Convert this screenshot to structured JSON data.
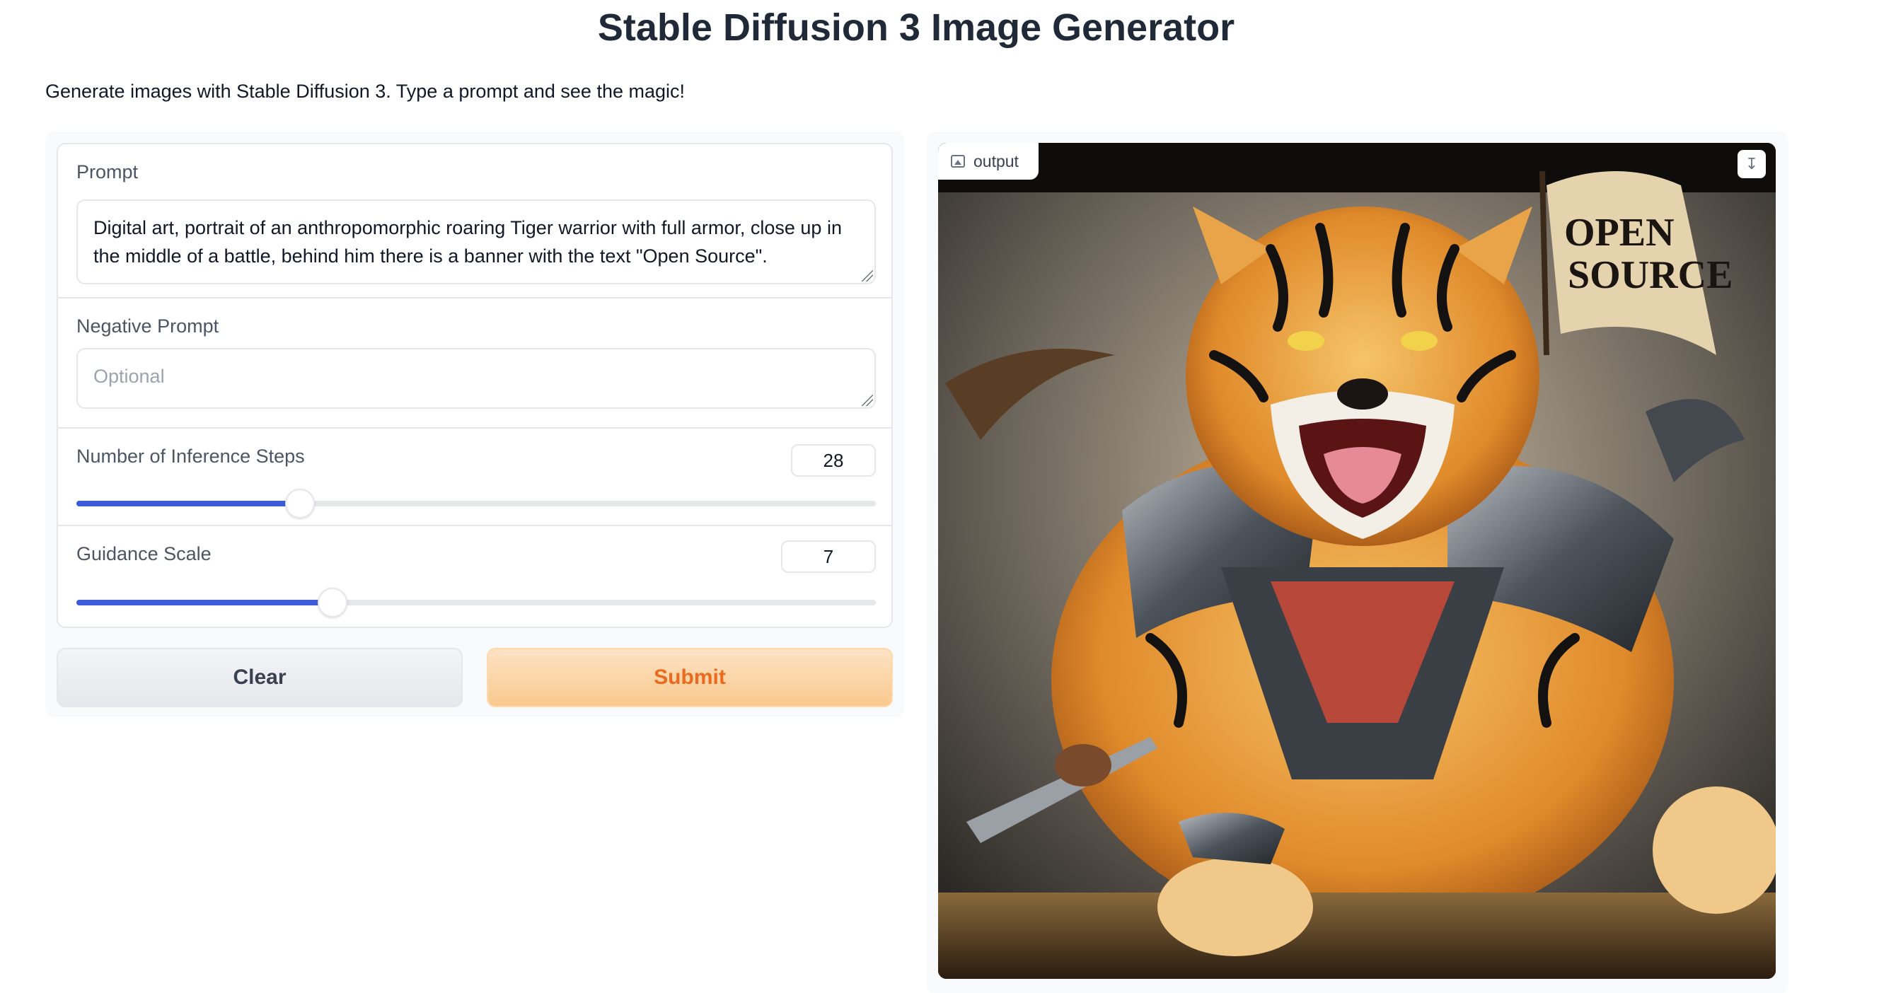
{
  "header": {
    "title": "Stable Diffusion 3 Image Generator",
    "description": "Generate images with Stable Diffusion 3. Type a prompt and see the magic!"
  },
  "form": {
    "prompt": {
      "label": "Prompt",
      "value": "Digital art, portrait of an anthropomorphic roaring Tiger warrior with full armor, close up in the middle of a battle, behind him there is a banner with the text \"Open Source\"."
    },
    "negative_prompt": {
      "label": "Negative Prompt",
      "placeholder": "Optional",
      "value": ""
    },
    "inference_steps": {
      "label": "Number of Inference Steps",
      "value": "28",
      "fraction": 0.28
    },
    "guidance_scale": {
      "label": "Guidance Scale",
      "value": "7",
      "fraction": 0.32
    }
  },
  "buttons": {
    "clear_label": "Clear",
    "submit_label": "Submit"
  },
  "output": {
    "label": "output",
    "label_icon": "image-icon",
    "download_icon": "download-icon",
    "banner_text": "OPEN SOURCE"
  },
  "colors": {
    "accent": "#3b5bdb",
    "submit_text": "#ea6a1f",
    "submit_bg": "#f9c98e"
  }
}
